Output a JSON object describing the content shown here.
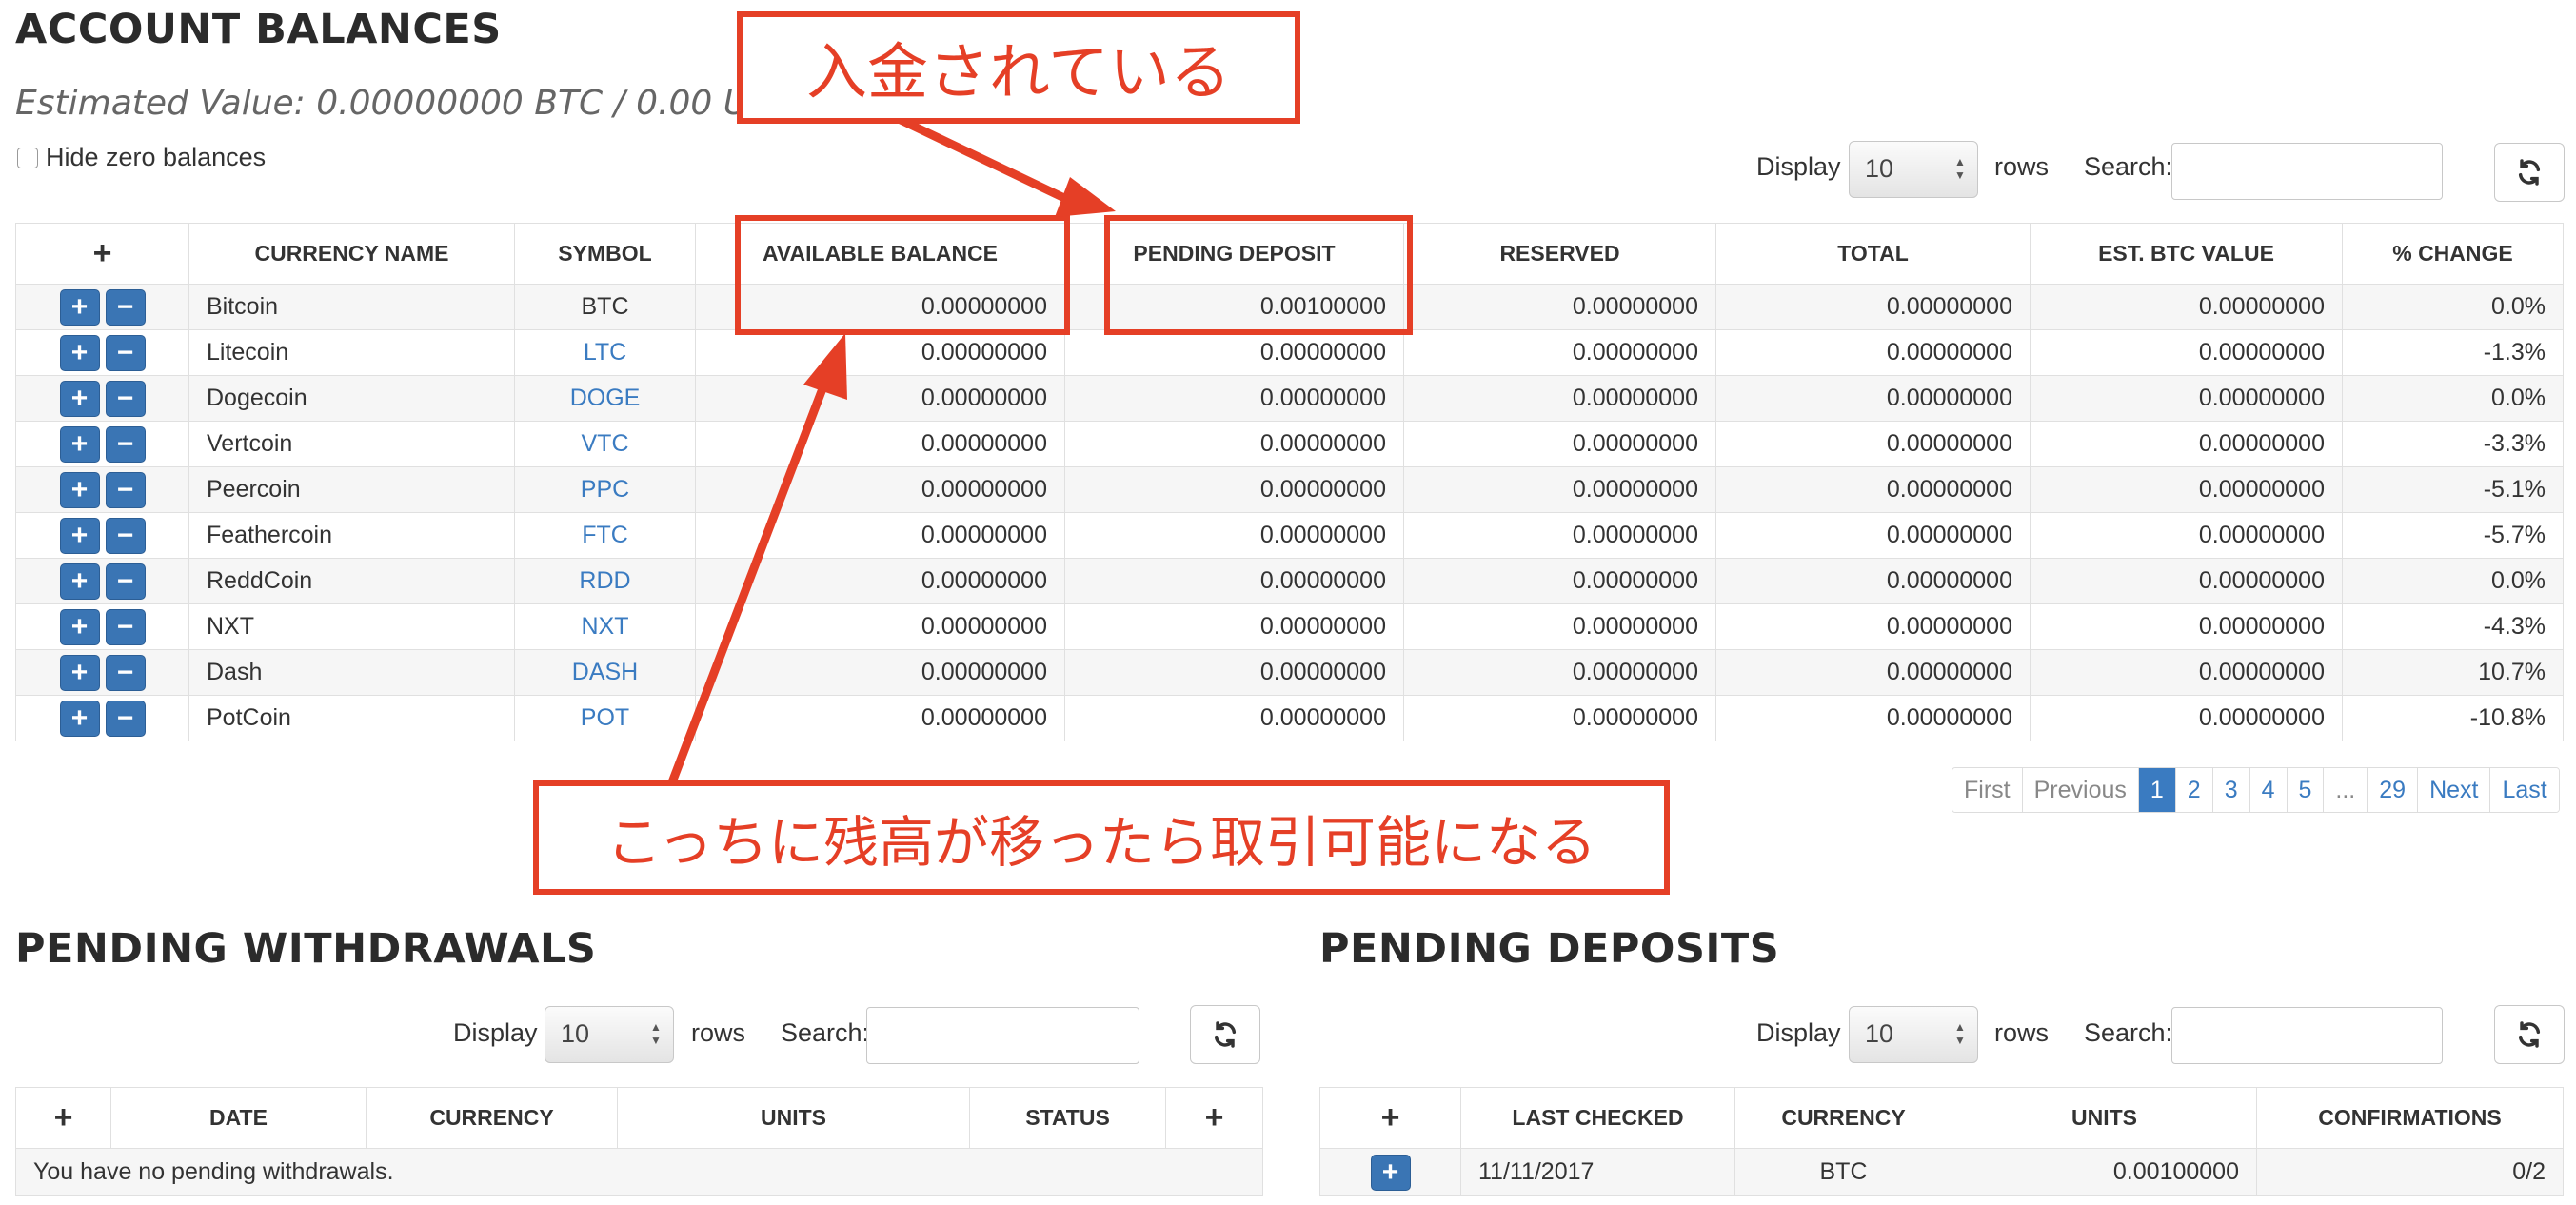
{
  "balances": {
    "title": "ACCOUNT BALANCES",
    "estimated": "Estimated Value: 0.00000000 BTC / 0.00 USD",
    "hide_zero_label": "Hide zero balances",
    "display_label": "Display",
    "rows_value": "10",
    "rows_label": "rows",
    "search_label": "Search:",
    "columns": [
      "+",
      "CURRENCY NAME",
      "SYMBOL",
      "AVAILABLE BALANCE",
      "PENDING DEPOSIT",
      "RESERVED",
      "TOTAL",
      "EST. BTC VALUE",
      "% CHANGE"
    ],
    "rows": [
      {
        "name": "Bitcoin",
        "symbol": "BTC",
        "available": "0.00000000",
        "pending": "0.00100000",
        "reserved": "0.00000000",
        "total": "0.00000000",
        "btc_value": "0.00000000",
        "change": "0.0%"
      },
      {
        "name": "Litecoin",
        "symbol": "LTC",
        "available": "0.00000000",
        "pending": "0.00000000",
        "reserved": "0.00000000",
        "total": "0.00000000",
        "btc_value": "0.00000000",
        "change": "-1.3%"
      },
      {
        "name": "Dogecoin",
        "symbol": "DOGE",
        "available": "0.00000000",
        "pending": "0.00000000",
        "reserved": "0.00000000",
        "total": "0.00000000",
        "btc_value": "0.00000000",
        "change": "0.0%"
      },
      {
        "name": "Vertcoin",
        "symbol": "VTC",
        "available": "0.00000000",
        "pending": "0.00000000",
        "reserved": "0.00000000",
        "total": "0.00000000",
        "btc_value": "0.00000000",
        "change": "-3.3%"
      },
      {
        "name": "Peercoin",
        "symbol": "PPC",
        "available": "0.00000000",
        "pending": "0.00000000",
        "reserved": "0.00000000",
        "total": "0.00000000",
        "btc_value": "0.00000000",
        "change": "-5.1%"
      },
      {
        "name": "Feathercoin",
        "symbol": "FTC",
        "available": "0.00000000",
        "pending": "0.00000000",
        "reserved": "0.00000000",
        "total": "0.00000000",
        "btc_value": "0.00000000",
        "change": "-5.7%"
      },
      {
        "name": "ReddCoin",
        "symbol": "RDD",
        "available": "0.00000000",
        "pending": "0.00000000",
        "reserved": "0.00000000",
        "total": "0.00000000",
        "btc_value": "0.00000000",
        "change": "0.0%"
      },
      {
        "name": "NXT",
        "symbol": "NXT",
        "available": "0.00000000",
        "pending": "0.00000000",
        "reserved": "0.00000000",
        "total": "0.00000000",
        "btc_value": "0.00000000",
        "change": "-4.3%"
      },
      {
        "name": "Dash",
        "symbol": "DASH",
        "available": "0.00000000",
        "pending": "0.00000000",
        "reserved": "0.00000000",
        "total": "0.00000000",
        "btc_value": "0.00000000",
        "change": "10.7%"
      },
      {
        "name": "PotCoin",
        "symbol": "POT",
        "available": "0.00000000",
        "pending": "0.00000000",
        "reserved": "0.00000000",
        "total": "0.00000000",
        "btc_value": "0.00000000",
        "change": "-10.8%"
      }
    ],
    "pagination": [
      "First",
      "Previous",
      "1",
      "2",
      "3",
      "4",
      "5",
      "...",
      "29",
      "Next",
      "Last"
    ],
    "current_page": "1"
  },
  "withdrawals": {
    "title": "PENDING WITHDRAWALS",
    "display_label": "Display",
    "rows_value": "10",
    "rows_label": "rows",
    "search_label": "Search:",
    "columns": [
      "+",
      "DATE",
      "CURRENCY",
      "UNITS",
      "STATUS",
      "+"
    ],
    "empty_message": "You have no pending withdrawals."
  },
  "deposits": {
    "title": "PENDING DEPOSITS",
    "display_label": "Display",
    "rows_value": "10",
    "rows_label": "rows",
    "search_label": "Search:",
    "columns": [
      "+",
      "LAST CHECKED",
      "CURRENCY",
      "UNITS",
      "CONFIRMATIONS"
    ],
    "rows": [
      {
        "last_checked": "11/11/2017",
        "currency": "BTC",
        "units": "0.00100000",
        "confirmations": "0/2"
      }
    ]
  },
  "annotations": {
    "deposited": "入金されている",
    "tradable": "こっちに残高が移ったら取引可能になる"
  },
  "colors": {
    "accent": "#3a7bc1",
    "button": "#3a75b4",
    "annotation": "#e53f26"
  }
}
